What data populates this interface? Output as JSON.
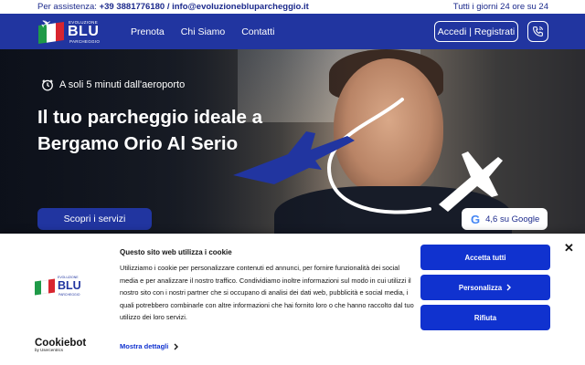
{
  "topbar": {
    "assist_label": "Per assistenza:",
    "phone": "+39 3881776180",
    "separator": "/",
    "email": "info@evoluzionebluparcheggio.it",
    "hours": "Tutti i giorni 24 ore su 24"
  },
  "logo": {
    "small": "EVOLUZIONE",
    "big": "BLU",
    "sub": "PARCHEGGIO"
  },
  "nav": {
    "items": [
      {
        "label": "Prenota"
      },
      {
        "label": "Chi Siamo"
      },
      {
        "label": "Contatti"
      }
    ],
    "login_label": "Accedi | Registrati",
    "phone_icon": "phone-icon"
  },
  "hero": {
    "badge_icon": "clock-icon",
    "badge": "A soli 5 minuti dall'aeroporto",
    "title": "Il tuo parcheggio ideale a Bergamo Orio Al Serio",
    "cta": "Scopri i servizi",
    "google_rating": "4,6 su Google"
  },
  "cookie": {
    "title": "Questo sito web utilizza i cookie",
    "text": "Utilizziamo i cookie per personalizzare contenuti ed annunci, per fornire funzionalità dei social media e per analizzare il nostro traffico. Condividiamo inoltre informazioni sul modo in cui utilizzi il nostro sito con i nostri partner che si occupano di analisi dei dati web, pubblicità e social media, i quali potrebbero combinarle con altre informazioni che hai fornito loro o che hanno raccolto dal tuo utilizzo dei loro servizi.",
    "details_link": "Mostra dettagli",
    "accept_all": "Accetta tutti",
    "customize": "Personalizza",
    "reject": "Rifiuta",
    "brand": "Cookiebot",
    "brand_sub": "by Usercentrics",
    "close_icon": "close-icon"
  },
  "colors": {
    "brand_blue": "#2135a0",
    "cookie_blue": "#1032cf"
  }
}
